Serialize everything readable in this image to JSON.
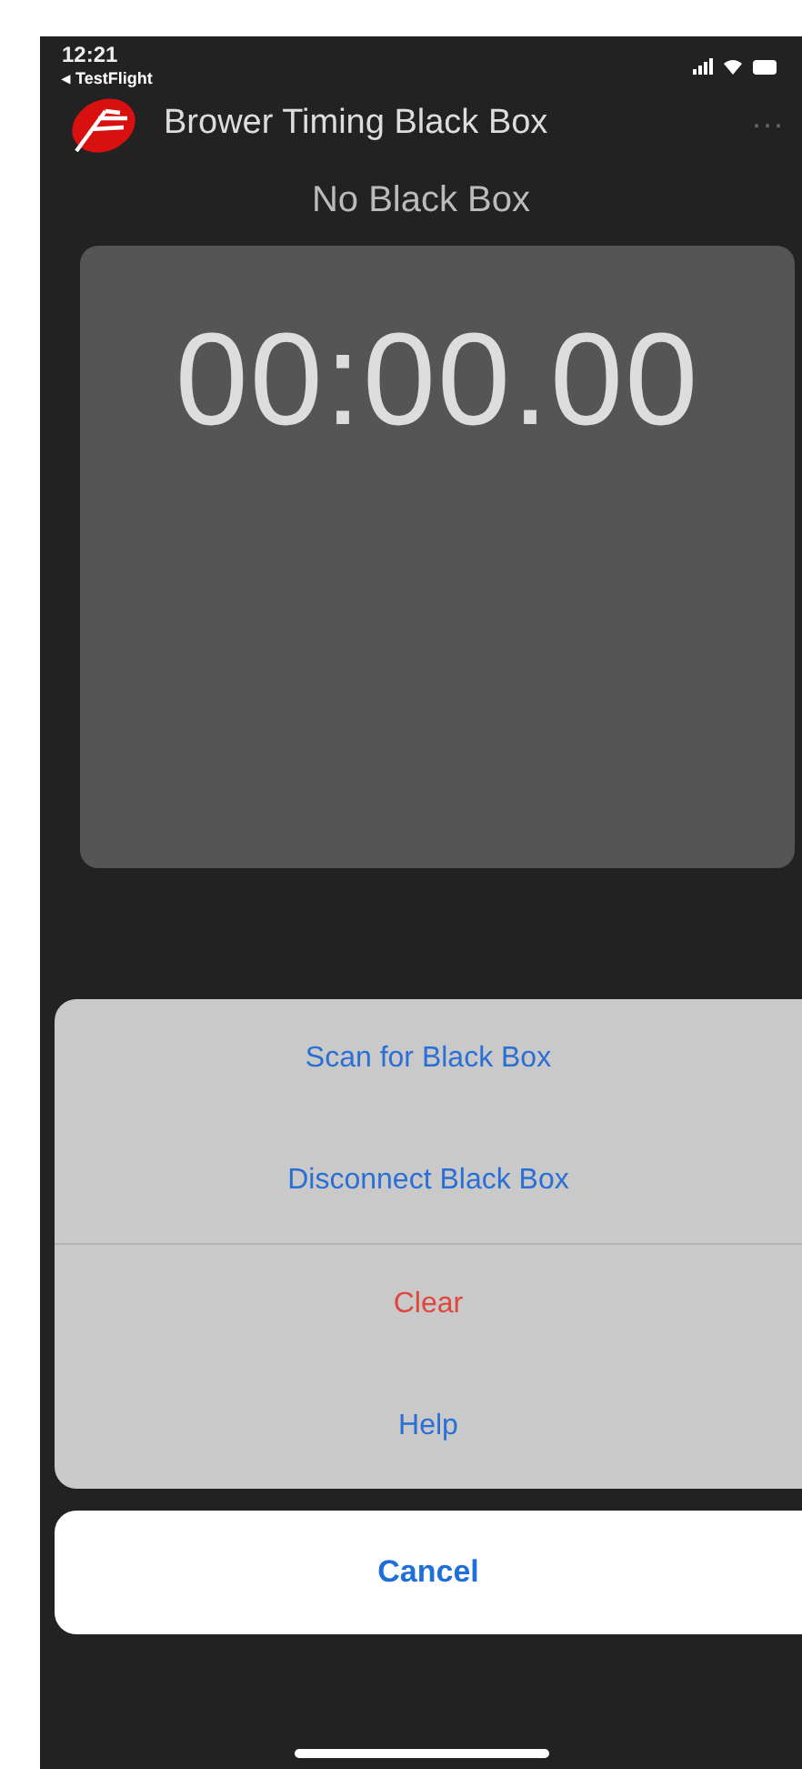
{
  "status_bar": {
    "time": "12:21",
    "back_label": "◂ TestFlight"
  },
  "header": {
    "title": "Brower Timing Black Box",
    "menu": "···"
  },
  "device_status": "No Black Box",
  "timer": "00:00.00",
  "action_sheet": {
    "actions": [
      {
        "label": "Scan for Black Box",
        "kind": "default"
      },
      {
        "label": "Disconnect Black Box",
        "kind": "default"
      },
      {
        "label": "Clear",
        "kind": "destructive"
      },
      {
        "label": "Help",
        "kind": "default"
      }
    ],
    "cancel": "Cancel"
  }
}
